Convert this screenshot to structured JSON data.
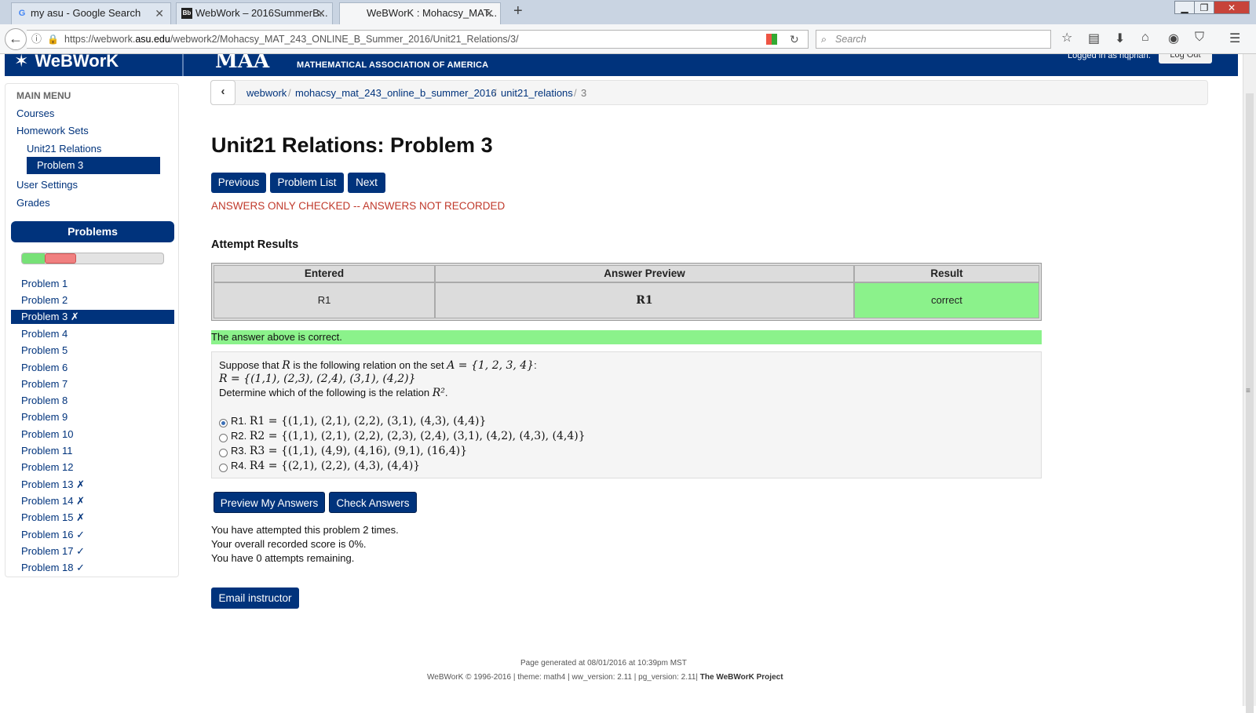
{
  "browser": {
    "tabs": [
      {
        "title": "my asu - Google Search",
        "favicon": "G"
      },
      {
        "title": "WebWork – 2016SummerB...",
        "favicon": "Bb"
      },
      {
        "title": "WeBWorK : Mohacsy_MAT...",
        "favicon": ""
      }
    ],
    "url_prefix": "https://webwork.",
    "url_domain": "asu.edu",
    "url_suffix": "/webwork2/Mohacsy_MAT_243_ONLINE_B_Summer_2016/Unit21_Relations/3/",
    "search_placeholder": "Search"
  },
  "header": {
    "logo_text": "WeBWorK",
    "maa_text": "MAA",
    "maa_sub": "MATHEMATICAL ASSOCIATION OF AMERICA",
    "logged_in": "Logged in as hqphan.",
    "logout_label": "Log Out"
  },
  "sidebar": {
    "main_menu": "MAIN MENU",
    "items": [
      "Courses",
      "Homework Sets",
      "Unit21 Relations",
      "Problem 3",
      "User Settings",
      "Grades"
    ],
    "problems_label": "Problems",
    "progress": {
      "correct_fraction": 0.16,
      "incorrect_fraction": 0.22
    },
    "problems": [
      "Problem 1",
      "Problem 2",
      "Problem 3 ✗",
      "Problem 4",
      "Problem 5",
      "Problem 6",
      "Problem 7",
      "Problem 8",
      "Problem 9",
      "Problem 10",
      "Problem 11",
      "Problem 12",
      "Problem 13 ✗",
      "Problem 14 ✗",
      "Problem 15 ✗",
      "Problem 16 ✓",
      "Problem 17 ✓",
      "Problem 18 ✓"
    ]
  },
  "breadcrumb": [
    "webwork",
    "mohacsy_mat_243_online_b_summer_2016",
    "unit21_relations",
    "3"
  ],
  "main": {
    "title": "Unit21 Relations: Problem 3",
    "nav_buttons": [
      "Previous",
      "Problem List",
      "Next"
    ],
    "status": "ANSWERS ONLY CHECKED -- ANSWERS NOT RECORDED",
    "attempt_title": "Attempt Results",
    "results": {
      "headers": [
        "Entered",
        "Answer Preview",
        "Result"
      ],
      "row": [
        "R1",
        "R1",
        "correct"
      ]
    },
    "correct_message": "The answer above is correct.",
    "problem": {
      "line1_pre": "Suppose that ",
      "line1_var": "R",
      "line1_mid": " is the following relation on the set ",
      "line1_set": "A = {1, 2, 3, 4}",
      "line1_end": ":",
      "line2": "R = {(1,1), (2,3), (2,4), (3,1), (4,2)}",
      "line3_pre": "Determine which of the following is the relation ",
      "line3_var": "R²",
      "line3_end": ".",
      "options": [
        {
          "label": "R1.",
          "expr": "R1 = {(1,1), (2,1), (2,2), (3,1), (4,3), (4,4)}",
          "selected": true
        },
        {
          "label": "R2.",
          "expr": "R2 = {(1,1), (2,1), (2,2), (2,3), (2,4), (3,1), (4,2), (4,3), (4,4)}",
          "selected": false
        },
        {
          "label": "R3.",
          "expr": "R3 = {(1,1), (4,9), (4,16), (9,1), (16,4)}",
          "selected": false
        },
        {
          "label": "R4.",
          "expr": "R4 = {(2,1), (2,2), (4,3), (4,4)}",
          "selected": false
        }
      ]
    },
    "action_buttons": [
      "Preview My Answers",
      "Check Answers"
    ],
    "info": [
      "You have attempted this problem 2 times.",
      "Your overall recorded score is 0%.",
      "You have 0 attempts remaining."
    ],
    "email_label": "Email instructor"
  },
  "footer": {
    "generated": "Page generated at 08/01/2016 at 10:39pm MST",
    "credits": "WeBWorK © 1996-2016 | theme: math4 | ww_version: 2.11 | pg_version: 2.11|",
    "project": "The WeBWorK Project"
  },
  "colors": {
    "brand": "#00337c",
    "correct": "#8bf28b",
    "warning": "#c0392b"
  }
}
